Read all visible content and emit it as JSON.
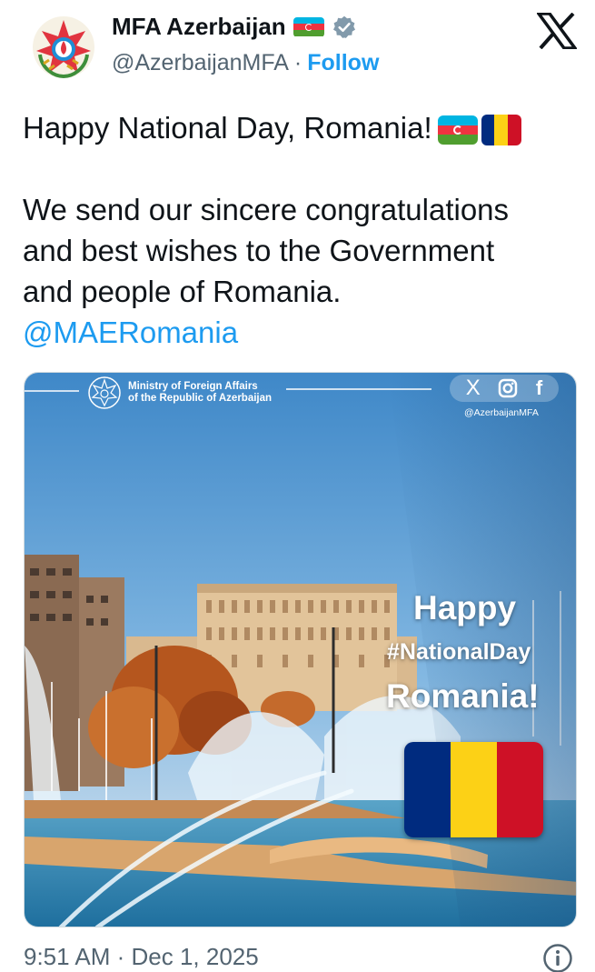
{
  "header": {
    "display_name": "MFA Azerbaijan",
    "handle": "@AzerbaijanMFA",
    "separator": "·",
    "follow_label": "Follow",
    "avatar_icon": "mfa-emblem-icon",
    "verified_icon": "verified-badge-icon",
    "platform_icon": "x-logo-icon"
  },
  "tweet": {
    "lines": [
      "Happy National Day, Romania!",
      "We send our sincere congratulations",
      "and best wishes to the Government",
      "and people of Romania."
    ],
    "mention": "@MAERomania"
  },
  "media": {
    "ministry_line1": "Ministry of Foreign Affairs",
    "ministry_line2": "of the Republic of Azerbaijan",
    "social_x": "X",
    "social_f": "f",
    "handle": "@AzerbaijanMFA",
    "happy": "Happy",
    "hashtag": "#NationalDay",
    "country": "Romania!"
  },
  "footer": {
    "timestamp": "9:51 AM · Dec 1, 2025",
    "info_icon": "info-icon"
  },
  "colors": {
    "az_blue": "#00b5e2",
    "az_red": "#ef3340",
    "az_green": "#509e2f",
    "ro_blue": "#002b7f",
    "ro_yellow": "#fcd116",
    "ro_red": "#ce1126",
    "link": "#1d9bf0",
    "muted": "#536471"
  }
}
